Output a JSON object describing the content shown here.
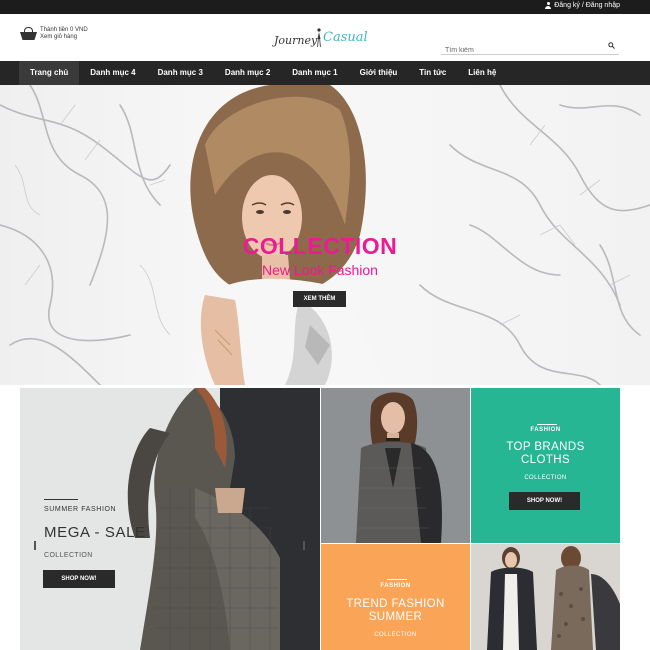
{
  "topbar": {
    "auth_text": "Đăng ký / Đăng nhập",
    "user_icon": "user-icon"
  },
  "header": {
    "cart_icon": "basket-icon",
    "cart_line1": "Thành tiền  0 VND",
    "cart_line2": "Xem giỏ hàng",
    "logo_word1": "Journey",
    "logo_word2": "Casual",
    "search_placeholder": "Tìm kiếm",
    "search_icon": "search-icon"
  },
  "nav": {
    "items": [
      {
        "label": "Trang chủ"
      },
      {
        "label": "Danh mục 4"
      },
      {
        "label": "Danh mục 3"
      },
      {
        "label": "Danh mục 2"
      },
      {
        "label": "Danh mục 1"
      },
      {
        "label": "Giới thiệu"
      },
      {
        "label": "Tin tức"
      },
      {
        "label": "Liên hệ"
      }
    ]
  },
  "hero": {
    "title": "COLLECTION",
    "subtitle": "New Look Fashion",
    "button": "XEM THÊM",
    "accent_color": "#ec1a93"
  },
  "banners": {
    "sale": {
      "kicker": "SUMMER FASHION",
      "title": "MEGA - SALE",
      "sub": "COLLECTION",
      "button": "SHOP NOW!"
    },
    "brands": {
      "kicker": "FASHION",
      "title_line1": "TOP BRANDS",
      "title_line2": "CLOTHS",
      "sub": "COLLECTION",
      "button": "SHOP NOW!",
      "color": "#26b693"
    },
    "trend": {
      "kicker": "FASHION",
      "title_line1": "TREND FASHION",
      "title_line2": "SUMMER",
      "sub": "COLLECTION",
      "color": "#f9a457"
    }
  }
}
